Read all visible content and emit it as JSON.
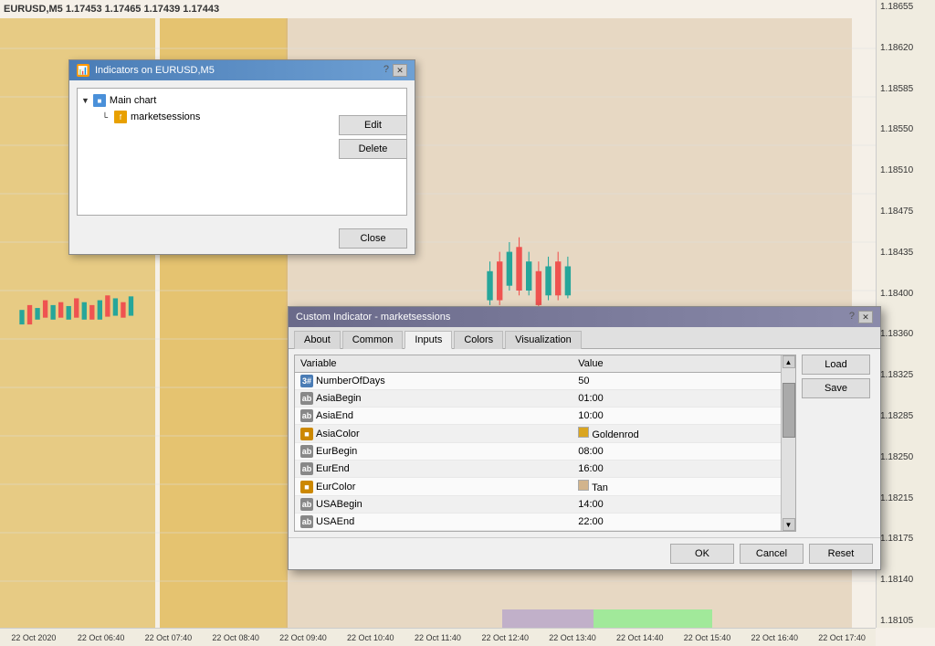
{
  "chart": {
    "symbol": "EURUSD,M5",
    "bid": "1.17453",
    "ask1": "1.17465",
    "ask2": "1.17439",
    "ask3": "1.17443",
    "header_label": "EURUSD,M5  1.17453 1.17465 1.17439 1.17443",
    "price_levels": [
      "1.18655",
      "1.18620",
      "1.18585",
      "1.18550",
      "1.18510",
      "1.18475",
      "1.18435",
      "1.18400",
      "1.18360",
      "1.18325",
      "1.18285",
      "1.18250",
      "1.18215",
      "1.18175",
      "1.18140",
      "1.18105"
    ],
    "time_labels": [
      "22 Oct 2020",
      "22 Oct 06:40",
      "22 Oct 07:40",
      "22 Oct 08:40",
      "22 Oct 09:40",
      "22 Oct 10:40",
      "22 Oct 11:40",
      "22 Oct 12:40",
      "22 Oct 13:40",
      "22 Oct 14:40",
      "22 Oct 15:40",
      "22 Oct 16:40",
      "22 Oct 17:40"
    ]
  },
  "dialog_indicators": {
    "title": "Indicators on EURUSD,M5",
    "tree": {
      "main_chart_label": "Main chart",
      "indicator_label": "marketsessions"
    },
    "buttons": {
      "edit": "Edit",
      "delete": "Delete",
      "close": "Close"
    }
  },
  "dialog_custom": {
    "title": "Custom Indicator - marketsessions",
    "tabs": [
      "About",
      "Common",
      "Inputs",
      "Colors",
      "Visualization"
    ],
    "active_tab": "Inputs",
    "table": {
      "col_variable": "Variable",
      "col_value": "Value",
      "rows": [
        {
          "icon": "int",
          "icon_label": "3#",
          "name": "NumberOfDays",
          "value": "50",
          "value_type": "text"
        },
        {
          "icon": "str",
          "icon_label": "ab",
          "name": "AsiaBegin",
          "value": "01:00",
          "value_type": "text"
        },
        {
          "icon": "str",
          "icon_label": "ab",
          "name": "AsiaEnd",
          "value": "10:00",
          "value_type": "text"
        },
        {
          "icon": "color",
          "icon_label": "■",
          "name": "AsiaColor",
          "value": "Goldenrod",
          "value_type": "color",
          "color_hex": "#DAA520"
        },
        {
          "icon": "str",
          "icon_label": "ab",
          "name": "EurBegin",
          "value": "08:00",
          "value_type": "text"
        },
        {
          "icon": "str",
          "icon_label": "ab",
          "name": "EurEnd",
          "value": "16:00",
          "value_type": "text"
        },
        {
          "icon": "color",
          "icon_label": "■",
          "name": "EurColor",
          "value": "Tan",
          "value_type": "color",
          "color_hex": "#D2B48C"
        },
        {
          "icon": "str",
          "icon_label": "ab",
          "name": "USABegin",
          "value": "14:00",
          "value_type": "text"
        },
        {
          "icon": "str",
          "icon_label": "ab",
          "name": "USAEnd",
          "value": "22:00",
          "value_type": "text"
        }
      ]
    },
    "buttons": {
      "load": "Load",
      "save": "Save",
      "ok": "OK",
      "cancel": "Cancel",
      "reset": "Reset"
    }
  }
}
